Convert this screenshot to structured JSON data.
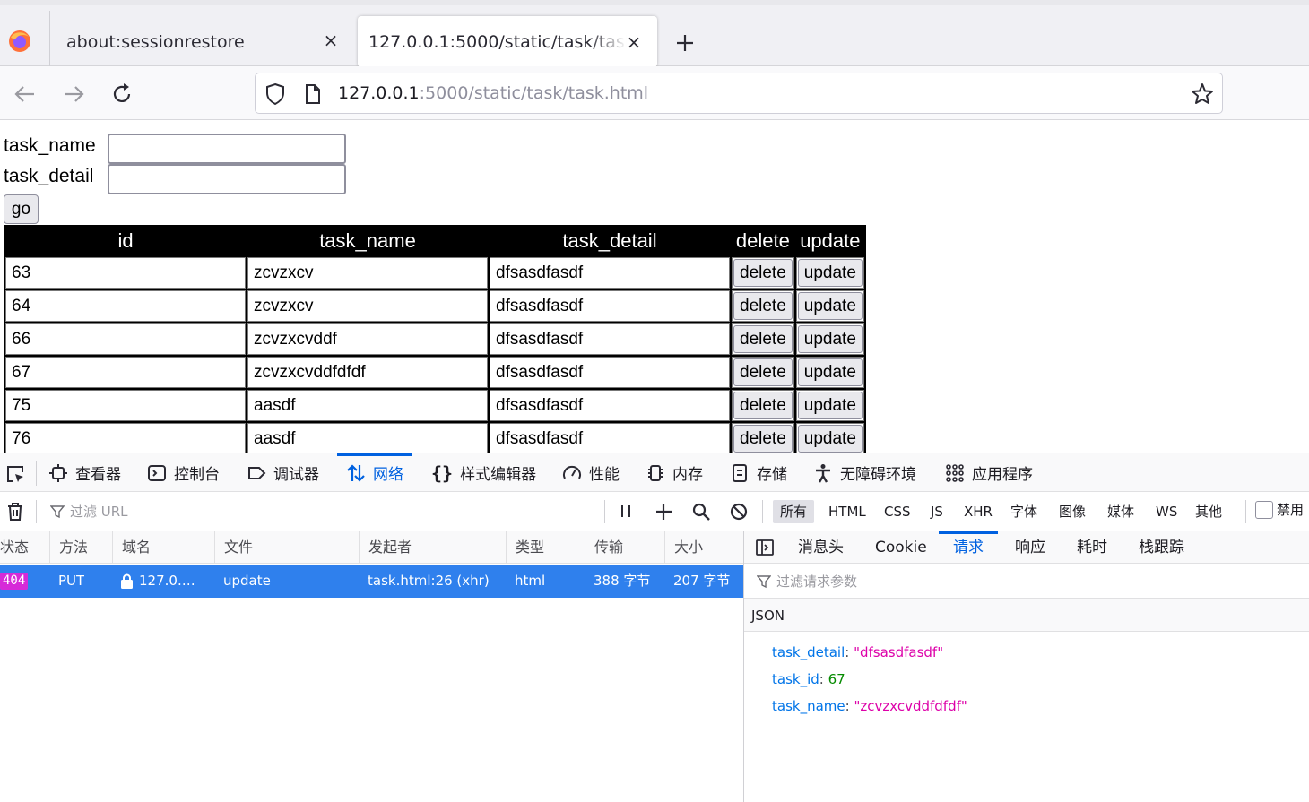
{
  "browser": {
    "tabs": [
      {
        "label": "about:sessionrestore",
        "close": "×"
      },
      {
        "label": "127.0.0.1:5000/static/task/task.html",
        "close": "×"
      }
    ],
    "new_tab": "+",
    "url_host": "127.0.0.1",
    "url_rest": ":5000/static/task/task.html"
  },
  "page": {
    "form": {
      "task_name_label": "task_name",
      "task_detail_label": "task_detail",
      "task_name_value": "",
      "task_detail_value": "",
      "go_label": "go"
    },
    "table": {
      "headers": [
        "id",
        "task_name",
        "task_detail",
        "delete",
        "update"
      ],
      "rows": [
        {
          "id": "63",
          "task_name": "zcvzxcv",
          "task_detail": "dfsasdfasdf",
          "delete": "delete",
          "update": "update"
        },
        {
          "id": "64",
          "task_name": "zcvzxcv",
          "task_detail": "dfsasdfasdf",
          "delete": "delete",
          "update": "update"
        },
        {
          "id": "66",
          "task_name": "zcvzxcvddf",
          "task_detail": "dfsasdfasdf",
          "delete": "delete",
          "update": "update"
        },
        {
          "id": "67",
          "task_name": "zcvzxcvddfdfdf",
          "task_detail": "dfsasdfasdf",
          "delete": "delete",
          "update": "update"
        },
        {
          "id": "75",
          "task_name": "aasdf",
          "task_detail": "dfsasdfasdf",
          "delete": "delete",
          "update": "update"
        },
        {
          "id": "76",
          "task_name": "aasdf",
          "task_detail": "dfsasdfasdf",
          "delete": "delete",
          "update": "update"
        }
      ]
    }
  },
  "devtools": {
    "tabs": [
      "查看器",
      "控制台",
      "调试器",
      "网络",
      "样式编辑器",
      "性能",
      "内存",
      "存储",
      "无障碍环境",
      "应用程序"
    ],
    "active_tab": "网络",
    "filter_placeholder": "过滤 URL",
    "type_filters": [
      "所有",
      "HTML",
      "CSS",
      "JS",
      "XHR",
      "字体",
      "图像",
      "媒体",
      "WS",
      "其他"
    ],
    "active_type_filter": "所有",
    "disable_cache_label": "禁用",
    "columns": [
      "状态",
      "方法",
      "域名",
      "文件",
      "发起者",
      "类型",
      "传输",
      "大小"
    ],
    "request": {
      "status": "404",
      "method": "PUT",
      "domain": "127.0.…",
      "file": "update",
      "initiator": "task.html:26 (xhr)",
      "type": "html",
      "transferred": "388 字节",
      "size": "207 字节"
    },
    "side_tabs": [
      "消息头",
      "Cookie",
      "请求",
      "响应",
      "耗时",
      "栈跟踪"
    ],
    "active_side_tab": "请求",
    "param_filter_placeholder": "过滤请求参数",
    "json_label": "JSON",
    "json": [
      {
        "key": "task_detail",
        "value": "\"dfsasdfasdf\"",
        "kind": "string"
      },
      {
        "key": "task_id",
        "value": "67",
        "kind": "number"
      },
      {
        "key": "task_name",
        "value": "\"zcvzxcvddfdfdf\"",
        "kind": "string"
      }
    ]
  },
  "colors": {
    "accent": "#0061e0",
    "selected_row": "#2f80ed",
    "status_404": "#d62ad8",
    "json_key": "#0074e8",
    "json_string": "#dd00a9",
    "json_number": "#058b00"
  }
}
